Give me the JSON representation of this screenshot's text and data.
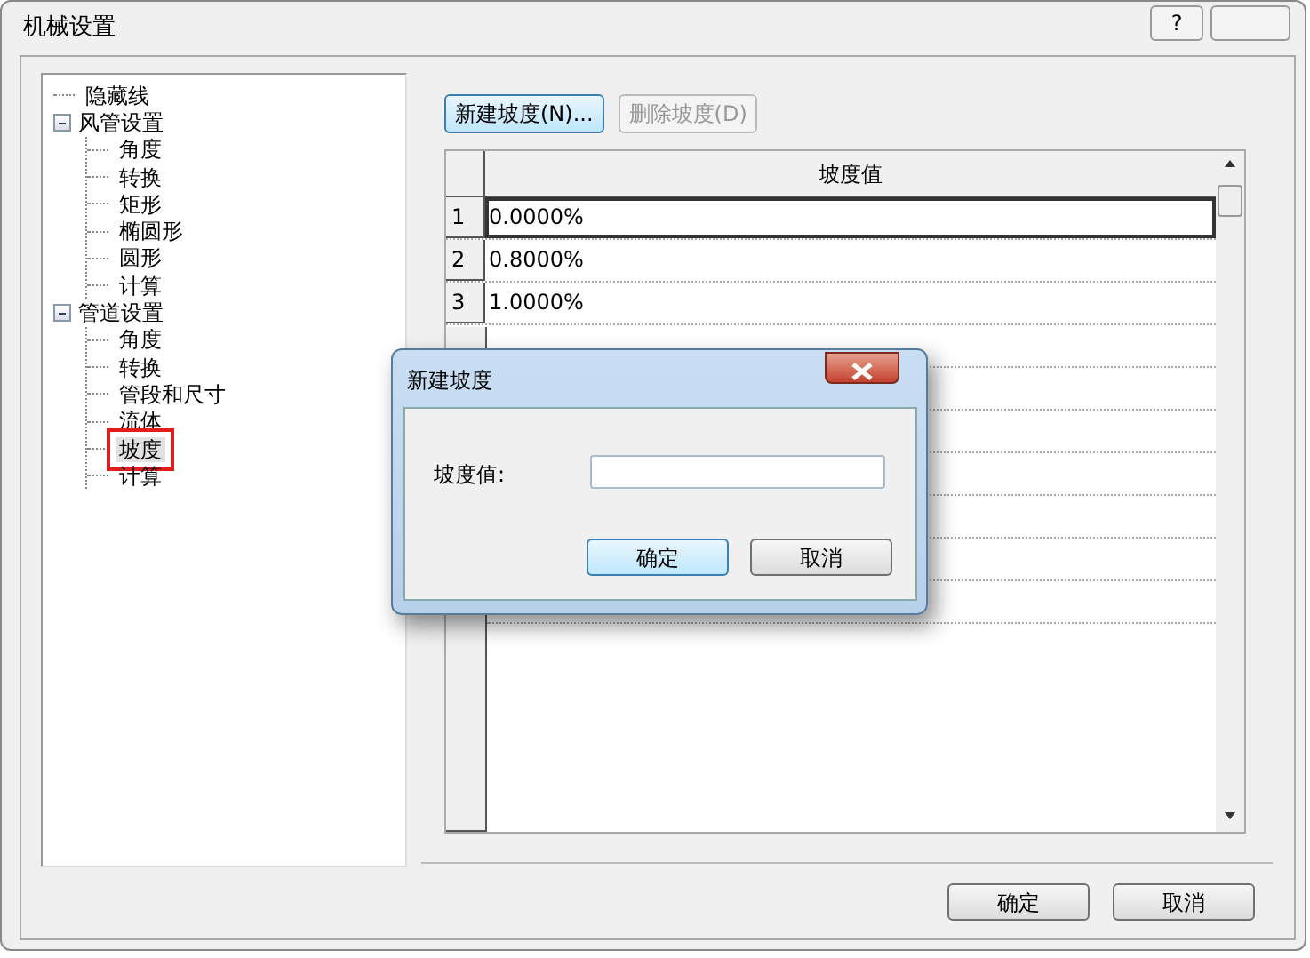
{
  "window": {
    "title": "机械设置",
    "help_button": "?"
  },
  "tree": [
    {
      "label": "隐藏线",
      "selected": false,
      "callout": false
    },
    {
      "label": "风管设置",
      "selected": false,
      "callout": false,
      "expanded": true,
      "children": [
        {
          "label": "角度",
          "selected": false,
          "callout": false
        },
        {
          "label": "转换",
          "selected": false,
          "callout": false
        },
        {
          "label": "矩形",
          "selected": false,
          "callout": false
        },
        {
          "label": "椭圆形",
          "selected": false,
          "callout": false
        },
        {
          "label": "圆形",
          "selected": false,
          "callout": false
        },
        {
          "label": "计算",
          "selected": false,
          "callout": false
        }
      ]
    },
    {
      "label": "管道设置",
      "selected": false,
      "callout": false,
      "expanded": true,
      "children": [
        {
          "label": "角度",
          "selected": false,
          "callout": false
        },
        {
          "label": "转换",
          "selected": false,
          "callout": false
        },
        {
          "label": "管段和尺寸",
          "selected": false,
          "callout": false
        },
        {
          "label": "流体",
          "selected": false,
          "callout": false
        },
        {
          "label": "坡度",
          "selected": true,
          "callout": true
        },
        {
          "label": "计算",
          "selected": false,
          "callout": false
        }
      ]
    }
  ],
  "toolbar": [
    {
      "label": "新建坡度(N)...",
      "disabled": false
    },
    {
      "label": "删除坡度(D)",
      "disabled": true
    }
  ],
  "table": {
    "columns": [
      "坡度值"
    ],
    "rows": [
      {
        "number": "1",
        "value": "0.0000%",
        "selected": true
      },
      {
        "number": "2",
        "value": "0.8000%",
        "selected": false
      },
      {
        "number": "3",
        "value": "1.0000%",
        "selected": false
      }
    ]
  },
  "buttons": [
    "确定",
    "取消"
  ],
  "dialog": {
    "title": "新建坡度",
    "field_label": "坡度值:",
    "buttons": [
      "确定",
      "取消"
    ]
  }
}
